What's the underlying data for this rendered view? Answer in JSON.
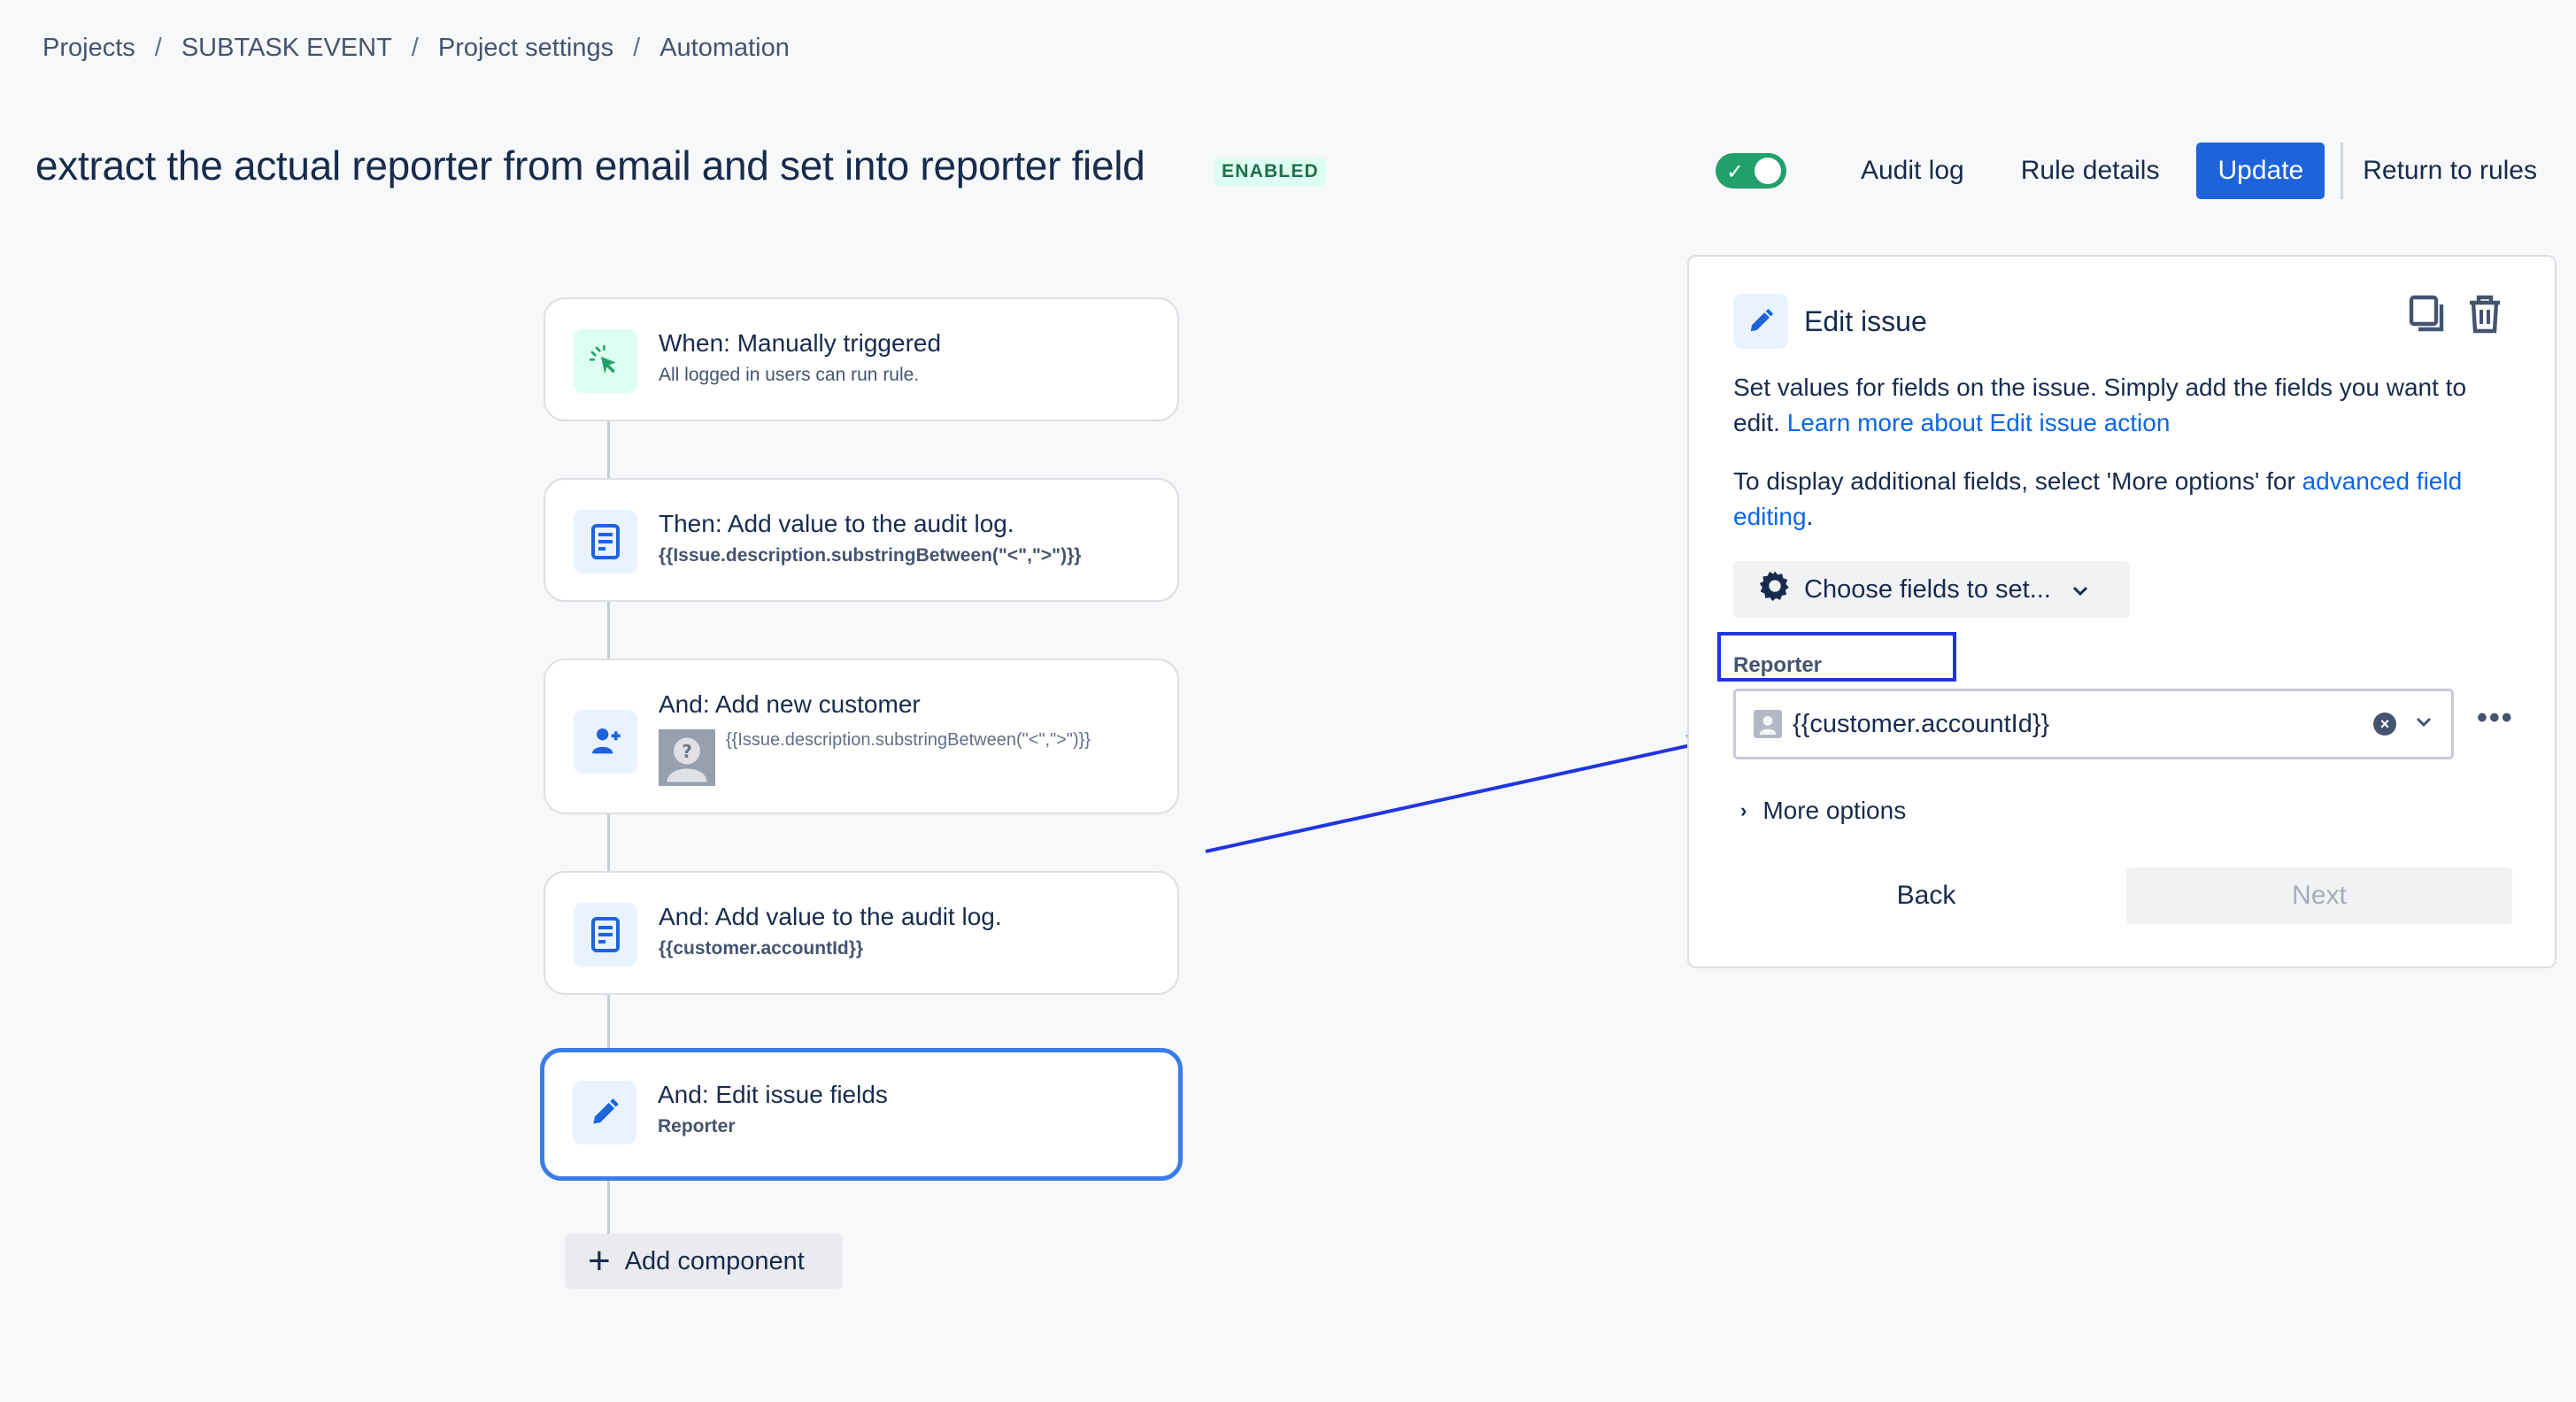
{
  "breadcrumb": [
    "Projects",
    "SUBTASK EVENT",
    "Project settings",
    "Automation"
  ],
  "breadcrumb_separator": "/",
  "rule": {
    "title": "extract the actual reporter from email and set into reporter field",
    "status": "ENABLED",
    "enabled": true
  },
  "header": {
    "toggle_check": "✓",
    "audit_log": "Audit log",
    "rule_details": "Rule details",
    "update": "Update",
    "return_to_rules": "Return to rules"
  },
  "flow": {
    "components": [
      {
        "icon": "cursor-click-icon",
        "title": "When: Manually triggered",
        "subtitle": "All logged in users can run rule."
      },
      {
        "icon": "document-icon",
        "title": "Then: Add value to the audit log.",
        "subtitle": "{{Issue.description.substringBetween(\"<\",\">\")}}"
      },
      {
        "icon": "add-user-icon",
        "title": "And: Add new customer",
        "subtitle": "{{Issue.description.substringBetween(\"<\",\">\")}}"
      },
      {
        "icon": "document-icon",
        "title": "And: Add value to the audit log.",
        "subtitle": "{{customer.accountId}}"
      },
      {
        "icon": "pencil-icon",
        "title": "And: Edit issue fields",
        "subtitle": "Reporter",
        "selected": true
      }
    ],
    "add_component": "Add component",
    "add_symbol": "+"
  },
  "panel": {
    "title": "Edit issue",
    "description_text": "Set values for fields on the issue. Simply add the fields you want to edit. ",
    "description_link": "Learn more about Edit issue action",
    "description2_text": "To display additional fields, select 'More options' for ",
    "description2_link": "advanced field editing",
    "description2_end": ".",
    "choose_fields": "Choose fields to set...",
    "field_label": "Reporter",
    "field_value": "{{customer.accountId}}",
    "clear_symbol": "×",
    "more_symbol": "•••",
    "more_options": "More options",
    "more_caret": "›",
    "back": "Back",
    "next": "Next"
  },
  "colors": {
    "primary": "#1d63dc",
    "toggle_on": "#22a06b",
    "annotation": "#1f35e0",
    "selected_border": "#3b7de8"
  }
}
